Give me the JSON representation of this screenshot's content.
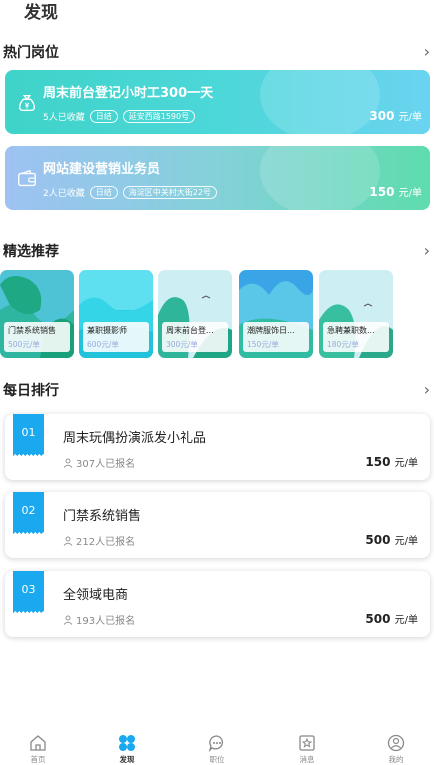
{
  "page_title": "发现",
  "sections": {
    "hot": "热门岗位",
    "featured": "精选推荐",
    "daily": "每日排行",
    "chevron": "›"
  },
  "hot_jobs": [
    {
      "title": "周末前台登记小时工300一天",
      "favorites": "5人已收藏",
      "pay_cycle": "日结",
      "location": "延安西路1590号",
      "price": "300",
      "unit": "元/单",
      "icon": "money-bag-icon"
    },
    {
      "title": "网站建设营销业务员",
      "favorites": "2人已收藏",
      "pay_cycle": "日结",
      "location": "海淀区中关村大街22号",
      "price": "150",
      "unit": "元/单",
      "icon": "wallet-icon"
    }
  ],
  "featured": [
    {
      "title": "门禁系统销售",
      "price": "500元/单"
    },
    {
      "title": "兼职摄影师",
      "price": "600元/单"
    },
    {
      "title": "周末前台登...",
      "price": "300元/单"
    },
    {
      "title": "潮牌服饰日...",
      "price": "150元/单"
    },
    {
      "title": "急聘兼职数...",
      "price": "180元/单"
    }
  ],
  "ranking": [
    {
      "rank": "01",
      "title": "周末玩偶扮演派发小礼品",
      "registered": "307人已报名",
      "price": "150",
      "unit": "元/单"
    },
    {
      "rank": "02",
      "title": "门禁系统销售",
      "registered": "212人已报名",
      "price": "500",
      "unit": "元/单"
    },
    {
      "rank": "03",
      "title": "全领域电商",
      "registered": "193人已报名",
      "price": "500",
      "unit": "元/单"
    }
  ],
  "tabs": [
    {
      "label": "首页",
      "icon": "home-icon",
      "active": false
    },
    {
      "label": "发现",
      "icon": "discover-icon",
      "active": true
    },
    {
      "label": "职位",
      "icon": "chat-icon",
      "active": false
    },
    {
      "label": "消息",
      "icon": "star-message-icon",
      "active": false
    },
    {
      "label": "我的",
      "icon": "profile-icon",
      "active": false
    }
  ],
  "colors": {
    "accent": "#1aa8ef",
    "hot_card_1": "#3fd3c9",
    "hot_card_2": "#9ec2f3"
  }
}
